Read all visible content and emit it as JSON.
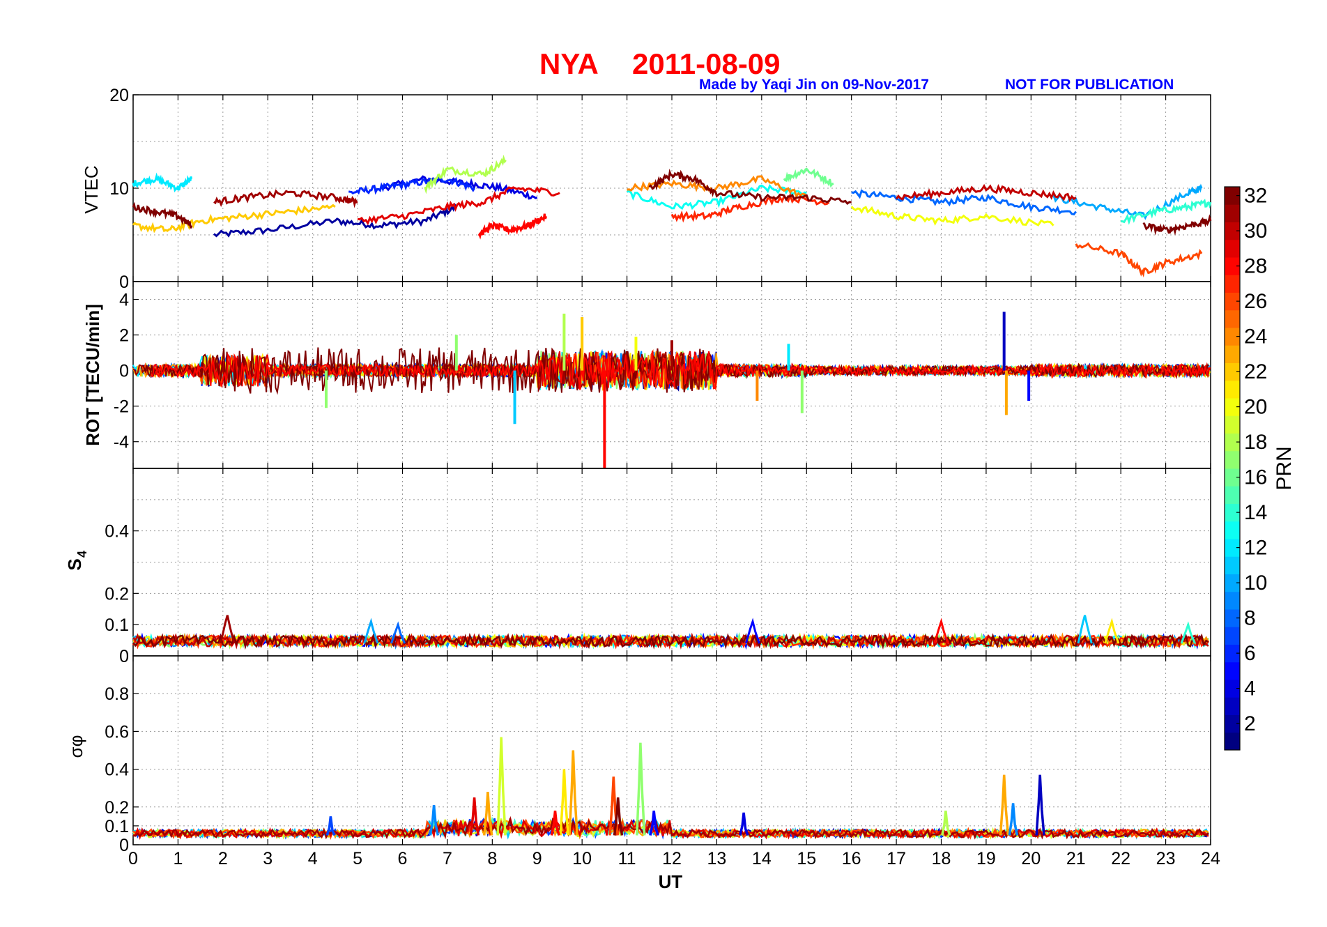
{
  "title": {
    "station": "NYA",
    "date": "2011-08-09",
    "credit": "Made by Yaqi Jin on 09-Nov-2017",
    "notice": "NOT FOR PUBLICATION"
  },
  "colorbar": {
    "label": "PRN",
    "range": [
      1,
      32
    ],
    "ticks": [
      "2",
      "4",
      "6",
      "8",
      "10",
      "12",
      "14",
      "16",
      "18",
      "20",
      "22",
      "24",
      "26",
      "28",
      "30",
      "32"
    ],
    "colormap": "jet"
  },
  "chart_data": [
    {
      "type": "line",
      "panel": "vtec",
      "ylabel": "VTEC",
      "xlim": [
        0,
        24
      ],
      "ylim": [
        0,
        20
      ],
      "yticks": [
        "0",
        "10",
        "20"
      ],
      "grid": true,
      "series": [
        {
          "prn": 2,
          "x": [
            1.8,
            3,
            4.5,
            5.5,
            6.5,
            7.2
          ],
          "y": [
            5,
            5.5,
            6.5,
            6,
            6.5,
            8
          ]
        },
        {
          "prn": 4,
          "x": [
            5.5,
            6.5,
            7.5,
            8.2,
            9
          ],
          "y": [
            10,
            11,
            10.5,
            10,
            9
          ]
        },
        {
          "prn": 6,
          "x": [
            4.8,
            5.5,
            6.2,
            7,
            7.6
          ],
          "y": [
            9.5,
            10,
            10.5,
            11,
            10
          ]
        },
        {
          "prn": 8,
          "x": [
            16,
            17,
            18,
            19,
            20,
            21
          ],
          "y": [
            9.5,
            9,
            8.5,
            9,
            8,
            7.5
          ]
        },
        {
          "prn": 10,
          "x": [
            20.5,
            21.5,
            22.5,
            23.5,
            23.8
          ],
          "y": [
            9,
            8,
            7,
            9.5,
            10
          ]
        },
        {
          "prn": 12,
          "x": [
            0,
            0.5,
            1,
            1.3
          ],
          "y": [
            10.5,
            11,
            10,
            11
          ]
        },
        {
          "prn": 13,
          "x": [
            11,
            12,
            13,
            14,
            15
          ],
          "y": [
            9.5,
            8,
            8.5,
            10,
            9.5
          ]
        },
        {
          "prn": 14,
          "x": [
            22,
            22.8,
            23.5,
            24
          ],
          "y": [
            6.5,
            7.5,
            8,
            8.5
          ]
        },
        {
          "prn": 16,
          "x": [
            14.5,
            15,
            15.6
          ],
          "y": [
            11,
            12,
            10.5
          ]
        },
        {
          "prn": 18,
          "x": [
            6.5,
            7,
            7.8,
            8.3
          ],
          "y": [
            10,
            12,
            11.5,
            13
          ]
        },
        {
          "prn": 20,
          "x": [
            16,
            17,
            18,
            19,
            20.5
          ],
          "y": [
            8,
            7,
            6.5,
            7,
            6
          ]
        },
        {
          "prn": 22,
          "x": [
            0,
            0.8,
            1.5,
            2.5,
            3.5,
            4.5
          ],
          "y": [
            6,
            5.5,
            6.5,
            7,
            7.5,
            8
          ]
        },
        {
          "prn": 24,
          "x": [
            11,
            12,
            13,
            14,
            15
          ],
          "y": [
            10,
            10.5,
            10,
            11,
            9
          ]
        },
        {
          "prn": 26,
          "x": [
            21,
            22,
            22.5,
            23,
            23.8
          ],
          "y": [
            4,
            3,
            1,
            2,
            3
          ]
        },
        {
          "prn": 27,
          "x": [
            12,
            12.8,
            13.5,
            14.5,
            15.5
          ],
          "y": [
            7,
            7,
            8,
            9,
            8.5
          ]
        },
        {
          "prn": 28,
          "x": [
            7.7,
            8,
            8.4,
            8.8,
            9.2
          ],
          "y": [
            5,
            6,
            5.5,
            6,
            7
          ]
        },
        {
          "prn": 29,
          "x": [
            5,
            6,
            7,
            7.8,
            8.5,
            9.5
          ],
          "y": [
            6.5,
            7,
            8,
            8.5,
            10,
            9.5
          ]
        },
        {
          "prn": 30,
          "x": [
            17,
            18,
            19,
            20,
            21
          ],
          "y": [
            9,
            9.5,
            10,
            9.5,
            9
          ]
        },
        {
          "prn": 31,
          "x": [
            1.8,
            2.5,
            3.5,
            4.5,
            5
          ],
          "y": [
            8.5,
            9,
            9.5,
            9,
            8.5
          ]
        },
        {
          "prn": 32,
          "x": [
            0,
            0.5,
            1,
            1.3
          ],
          "y": [
            8,
            7.5,
            7,
            6
          ]
        },
        {
          "prn": 32,
          "x": [
            11.5,
            12,
            12.5,
            13,
            14,
            15,
            16
          ],
          "y": [
            10,
            11.5,
            11,
            9.5,
            9,
            9,
            8.5
          ]
        },
        {
          "prn": 32,
          "x": [
            22.5,
            23,
            23.5,
            24
          ],
          "y": [
            6,
            5.5,
            6,
            6.5
          ]
        }
      ]
    },
    {
      "type": "line",
      "panel": "rot",
      "ylabel": "ROT [TECU/min]",
      "xlim": [
        0,
        24
      ],
      "ylim": [
        -5.5,
        5
      ],
      "yticks": [
        "4",
        "2",
        "0",
        "-2",
        "-4"
      ],
      "grid": true,
      "spikes": [
        {
          "prn": 3,
          "x": 19.4,
          "y": 3.3
        },
        {
          "prn": 18,
          "x": 9.6,
          "y": 3.2
        },
        {
          "prn": 22,
          "x": 10.0,
          "y": 3.0
        },
        {
          "prn": 28,
          "x": 10.5,
          "y": -5.5
        },
        {
          "prn": 23,
          "x": 19.45,
          "y": -2.5
        },
        {
          "prn": 11,
          "x": 8.5,
          "y": -3.0
        },
        {
          "prn": 17,
          "x": 4.3,
          "y": -2.1
        },
        {
          "prn": 17,
          "x": 14.9,
          "y": -2.4
        },
        {
          "prn": 5,
          "x": 19.95,
          "y": -1.7
        },
        {
          "prn": 17,
          "x": 7.2,
          "y": 2.0
        },
        {
          "prn": 12,
          "x": 14.6,
          "y": 1.5
        },
        {
          "prn": 31,
          "x": 12.0,
          "y": 1.7
        },
        {
          "prn": 20,
          "x": 11.2,
          "y": 1.9
        },
        {
          "prn": 24,
          "x": 13.9,
          "y": -1.7
        }
      ]
    },
    {
      "type": "line",
      "panel": "s4",
      "ylabel": "S4",
      "xlim": [
        0,
        24
      ],
      "ylim": [
        0,
        0.6
      ],
      "yticks": [
        "0",
        "0.1",
        "0.2",
        "0.4"
      ],
      "grid": true,
      "peaks": [
        {
          "prn": 31,
          "x": 2.1,
          "y": 0.13
        },
        {
          "prn": 10,
          "x": 5.3,
          "y": 0.11
        },
        {
          "prn": 8,
          "x": 5.9,
          "y": 0.1
        },
        {
          "prn": 5,
          "x": 13.8,
          "y": 0.11
        },
        {
          "prn": 28,
          "x": 18.0,
          "y": 0.11
        },
        {
          "prn": 11,
          "x": 21.2,
          "y": 0.13
        },
        {
          "prn": 21,
          "x": 21.8,
          "y": 0.11
        },
        {
          "prn": 14,
          "x": 23.5,
          "y": 0.1
        }
      ]
    },
    {
      "type": "line",
      "panel": "sigma_phi",
      "ylabel": "σφ",
      "xlabel": "UT",
      "xlim": [
        0,
        24
      ],
      "ylim": [
        0,
        1
      ],
      "xticks": [
        "0",
        "1",
        "2",
        "3",
        "4",
        "5",
        "6",
        "7",
        "8",
        "9",
        "10",
        "11",
        "12",
        "13",
        "14",
        "15",
        "16",
        "17",
        "18",
        "19",
        "20",
        "21",
        "22",
        "23",
        "24"
      ],
      "yticks": [
        "0",
        "0.1",
        "0.2",
        "0.4",
        "0.6",
        "0.8"
      ],
      "grid": true,
      "peaks": [
        {
          "prn": 19,
          "x": 8.2,
          "y": 0.57
        },
        {
          "prn": 23,
          "x": 9.8,
          "y": 0.5
        },
        {
          "prn": 21,
          "x": 9.6,
          "y": 0.4
        },
        {
          "prn": 17,
          "x": 11.3,
          "y": 0.54
        },
        {
          "prn": 26,
          "x": 10.7,
          "y": 0.36
        },
        {
          "prn": 29,
          "x": 7.6,
          "y": 0.25
        },
        {
          "prn": 23,
          "x": 19.4,
          "y": 0.37
        },
        {
          "prn": 3,
          "x": 20.2,
          "y": 0.37
        },
        {
          "prn": 9,
          "x": 6.7,
          "y": 0.21
        },
        {
          "prn": 23,
          "x": 7.9,
          "y": 0.28
        },
        {
          "prn": 32,
          "x": 10.8,
          "y": 0.25
        },
        {
          "prn": 28,
          "x": 9.4,
          "y": 0.18
        },
        {
          "prn": 5,
          "x": 11.6,
          "y": 0.18
        },
        {
          "prn": 4,
          "x": 13.6,
          "y": 0.17
        },
        {
          "prn": 7,
          "x": 4.4,
          "y": 0.15
        },
        {
          "prn": 18,
          "x": 18.1,
          "y": 0.18
        },
        {
          "prn": 9,
          "x": 19.6,
          "y": 0.22
        }
      ]
    }
  ]
}
